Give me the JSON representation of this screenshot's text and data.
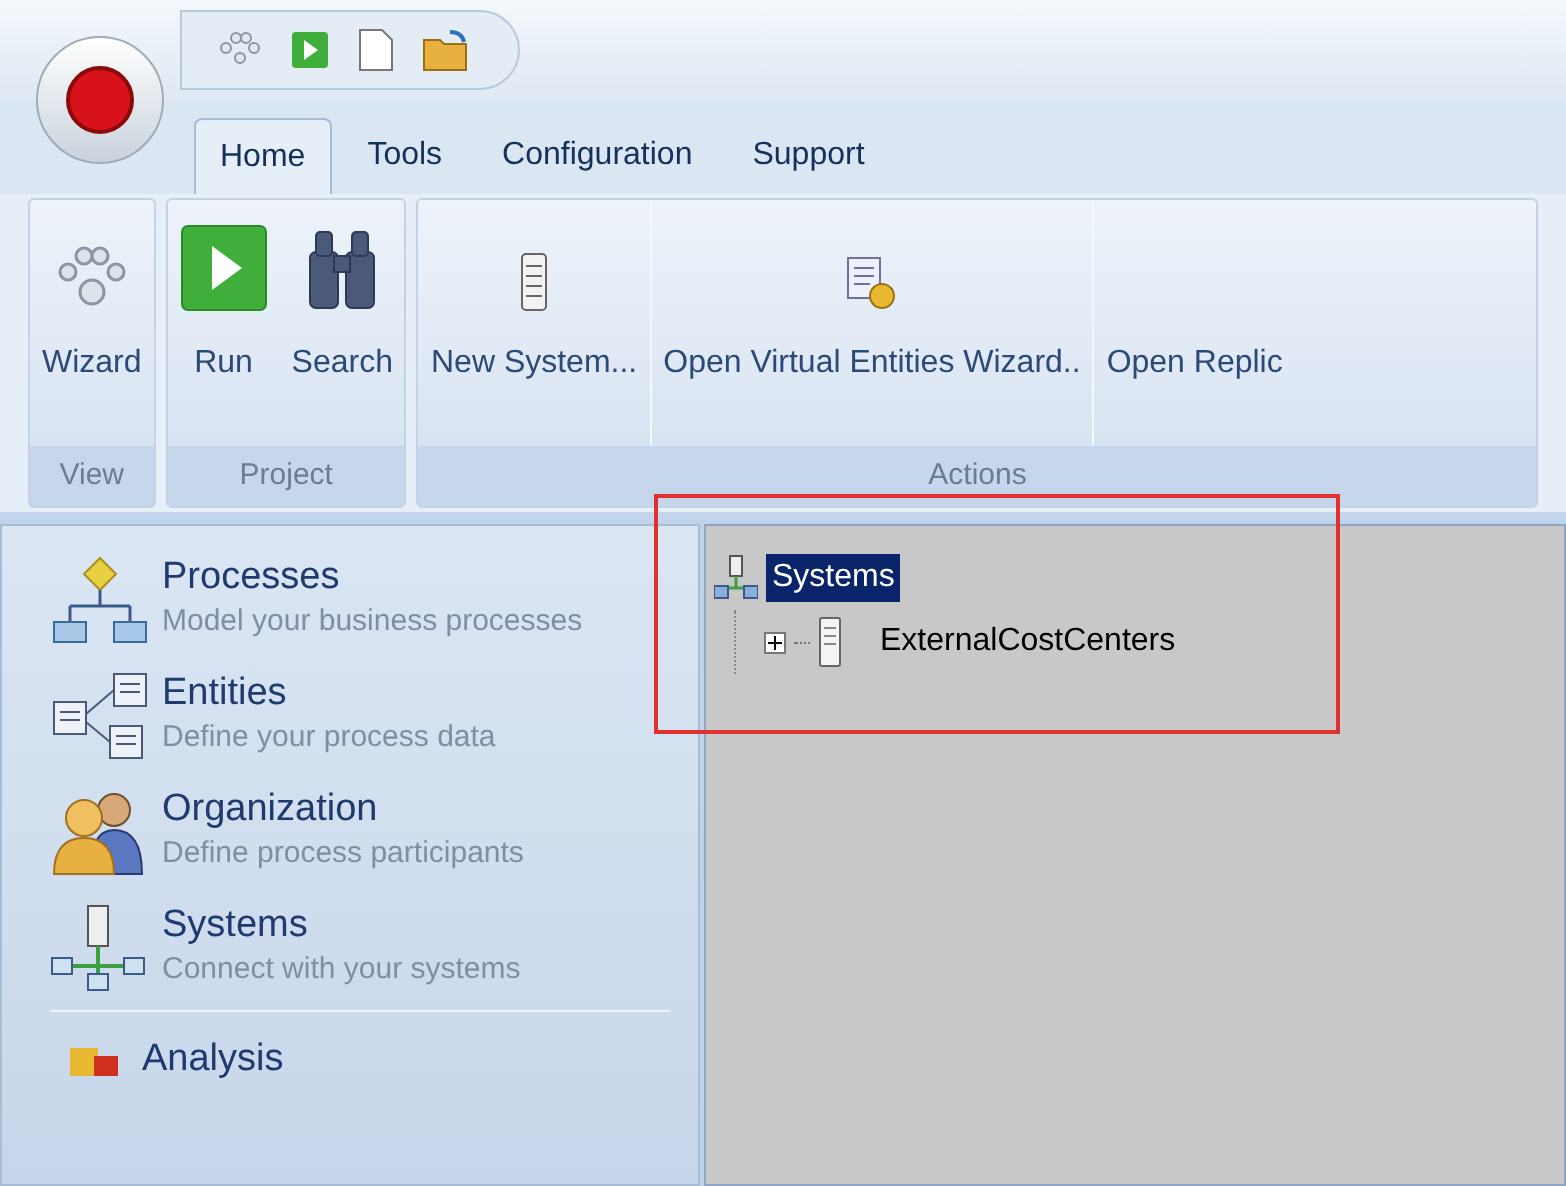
{
  "ribbon_tabs": [
    {
      "label": "Home",
      "selected": true
    },
    {
      "label": "Tools",
      "selected": false
    },
    {
      "label": "Configuration",
      "selected": false
    },
    {
      "label": "Support",
      "selected": false
    }
  ],
  "ribbon_groups": [
    {
      "label": "View",
      "buttons": [
        {
          "label": "Wizard",
          "kind": "wizard"
        }
      ]
    },
    {
      "label": "Project",
      "buttons": [
        {
          "label": "Run",
          "kind": "run"
        },
        {
          "label": "Search",
          "kind": "search"
        }
      ]
    },
    {
      "label": "Actions",
      "buttons": [
        {
          "label": "New System...",
          "kind": "server"
        },
        {
          "label": "Open Virtual Entities Wizard..",
          "kind": "entities"
        },
        {
          "label": "Open Replic",
          "kind": "none"
        }
      ]
    }
  ],
  "navigation": [
    {
      "title": "Processes",
      "description": "Model your business processes",
      "kind": "processes"
    },
    {
      "title": "Entities",
      "description": "Define your process data",
      "kind": "entities"
    },
    {
      "title": "Organization",
      "description": "Define process participants",
      "kind": "people"
    },
    {
      "title": "Systems",
      "description": "Connect with your systems",
      "kind": "systems"
    },
    {
      "title": "Analysis",
      "kind": "analysis"
    }
  ],
  "tree": {
    "label": "Systems",
    "selected": true,
    "expanded": true,
    "children": [
      {
        "label": "ExternalCostCenters",
        "expanded": false,
        "selected": false
      }
    ]
  }
}
